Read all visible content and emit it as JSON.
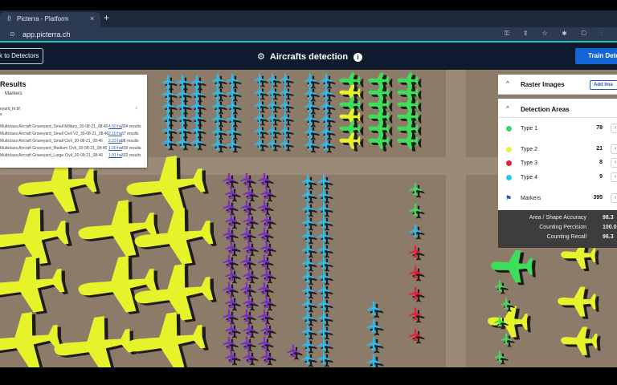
{
  "browser": {
    "tab_title": "Picterra - Platform",
    "tab_close": "×",
    "new_tab": "+",
    "url": "app.picterra.ch",
    "lock_icon": "lock-icon",
    "tools": [
      "⚿",
      "⇪",
      "☆",
      "✱",
      "▢",
      "⋮"
    ]
  },
  "app": {
    "back_label": "k to Detectors",
    "title": "Aircrafts detection",
    "gear_glyph": "⚙",
    "info_glyph": "i",
    "train_label": "Train Detec"
  },
  "results": {
    "heading": "Results",
    "markers_label": "Markers",
    "file_line1": "eyard_hr.tif",
    "file_line2": "s",
    "close_glyph": "×",
    "rows": [
      {
        "name": "Multiclass Aircraft Graveyard_Small Military_30-08-21_08:46",
        "size": "4.50 ha",
        "count": "304 results"
      },
      {
        "name": "Multiclass Aircraft Graveyard_Small Civil V2_30-08-21_08:46",
        "size": "2.10 ha",
        "count": "37 results"
      },
      {
        "name": "Multiclass Aircraft Graveyard_Small Civil_30-08-21_08:46",
        "size": "2.23 ha",
        "count": "98 results"
      },
      {
        "name": "Multiclass Aircraft Graveyard_Medium Civil_30-08-21_08:46",
        "size": "1.00 ha",
        "count": "439 results"
      },
      {
        "name": "Multiclass Aircraft Graveyard_Large Civil_30-08-21_08:46",
        "size": "1.91 ha",
        "count": "332 results"
      }
    ]
  },
  "panel": {
    "raster_label": "Raster Images",
    "add_label": "Add Ima",
    "detection_label": "Detection Areas",
    "chevron": "^",
    "types": [
      {
        "name": "Type 1",
        "count": "78",
        "color": "#3ad36b"
      },
      {
        "name": "Type 2",
        "count": "21",
        "color": "#e7f23a"
      },
      {
        "name": "Type 3",
        "count": "8",
        "color": "#e3223a"
      },
      {
        "name": "Type 4",
        "count": "9",
        "color": "#29c6ee"
      }
    ],
    "markers": {
      "name": "Markers",
      "count": "395",
      "icon": "flag-icon"
    },
    "toggle_glyph": "‹",
    "metrics": [
      {
        "label": "Area / Shape Accuracy",
        "value": "98.3"
      },
      {
        "label": "Counting Percision",
        "value": "100.0"
      },
      {
        "label": "Counting Recall",
        "value": "96.3"
      }
    ]
  },
  "colors": {
    "yellow": "#e6f22a",
    "purple": "#7b2fc4",
    "blue": "#29bdf0",
    "green": "#3ddf5a",
    "red": "#e3223a",
    "ground": "#8d7b69",
    "accent": "#1fc3b9",
    "header": "#0e1a2e"
  }
}
